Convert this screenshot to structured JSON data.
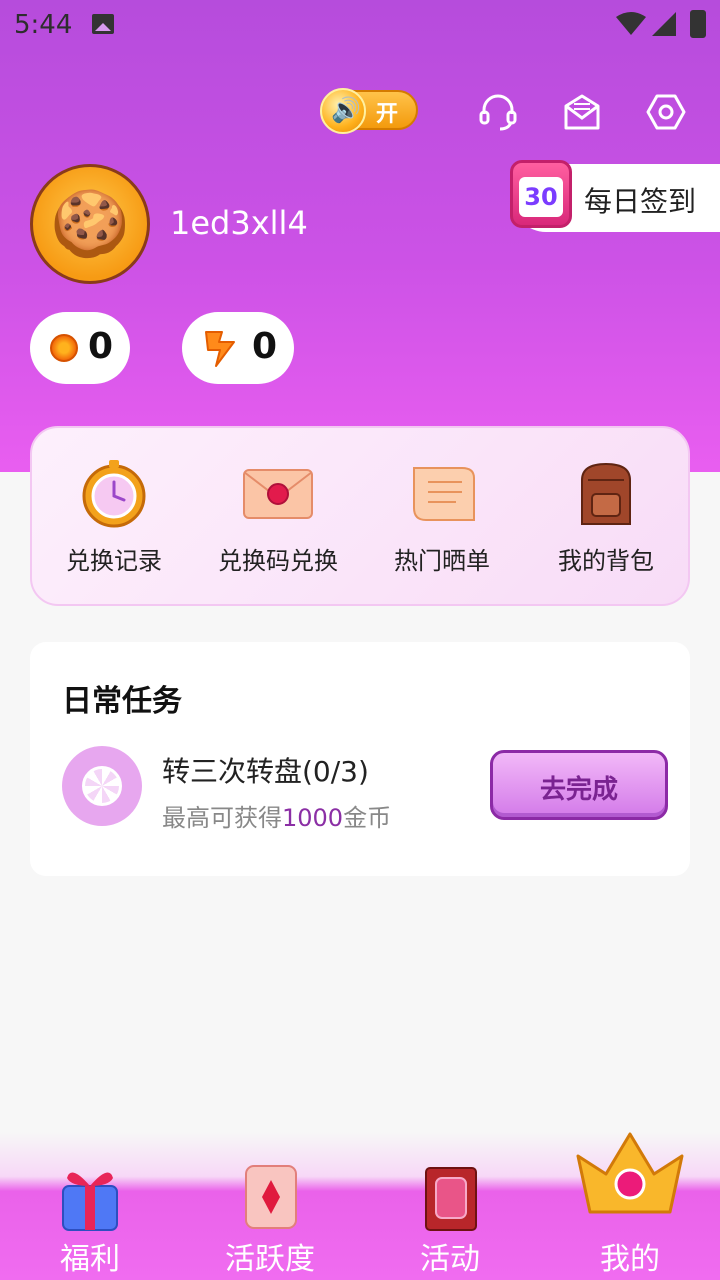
{
  "status_bar": {
    "time": "5:44"
  },
  "top_actions": {
    "sound_toggle_label": "开"
  },
  "profile": {
    "username": "1ed3xll4"
  },
  "daily_checkin": {
    "calendar_number": "30",
    "label": "每日签到"
  },
  "balances": {
    "coins": "0",
    "energy": "0"
  },
  "quick_menu": [
    {
      "label": "兑换记录",
      "icon": "clock-icon"
    },
    {
      "label": "兑换码兑换",
      "icon": "envelope-icon"
    },
    {
      "label": "热门晒单",
      "icon": "scroll-icon"
    },
    {
      "label": "我的背包",
      "icon": "backpack-icon"
    }
  ],
  "daily_tasks": {
    "title": "日常任务",
    "task": {
      "name": "转三次转盘(0/3)",
      "desc_prefix": "最高可获得",
      "desc_amount": "1000",
      "desc_suffix": "金币",
      "button": "去完成"
    }
  },
  "bottom_nav": [
    {
      "label": "福利",
      "icon": "gift-icon"
    },
    {
      "label": "活跃度",
      "icon": "card-icon"
    },
    {
      "label": "活动",
      "icon": "book-icon"
    },
    {
      "label": "我的",
      "icon": "crown-icon",
      "active": true
    }
  ],
  "colors": {
    "hero_top": "#b64cdc",
    "hero_bottom": "#e95ef0",
    "accent_purple": "#8b2fa5",
    "nav_bg": "#f06cf0"
  }
}
